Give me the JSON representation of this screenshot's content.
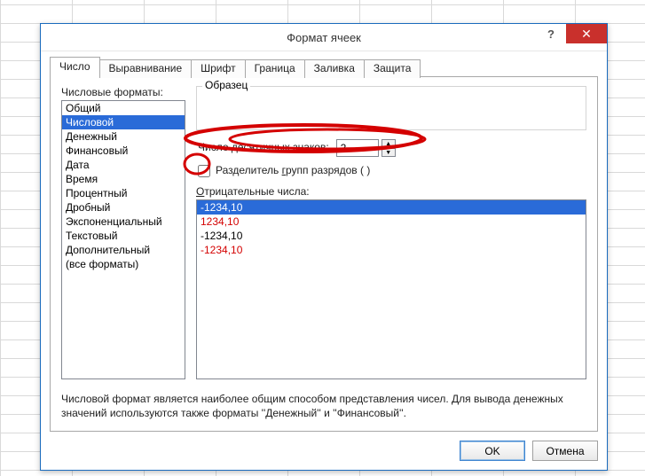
{
  "window": {
    "title": "Формат ячеек",
    "help": "?",
    "close": "✕"
  },
  "tabs": {
    "number": "Число",
    "alignment": "Выравнивание",
    "font": "Шрифт",
    "border": "Граница",
    "fill": "Заливка",
    "protection": "Защита"
  },
  "labels": {
    "formats": "Числовые форматы:",
    "sample": "Образец",
    "decimals_pre": "Число десятичных ",
    "decimals_under": "з",
    "decimals_post": "наков:",
    "thousands_pre": "Разделитель ",
    "thousands_under": "г",
    "thousands_post": "рупп разрядов ( )",
    "negatives_pre": "",
    "negatives_under": "О",
    "negatives_post": "трицательные числа:"
  },
  "formats": {
    "items": [
      {
        "label": "Общий"
      },
      {
        "label": "Числовой"
      },
      {
        "label": "Денежный"
      },
      {
        "label": "Финансовый"
      },
      {
        "label": "Дата"
      },
      {
        "label": "Время"
      },
      {
        "label": "Процентный"
      },
      {
        "label": "Дробный"
      },
      {
        "label": "Экспоненциальный"
      },
      {
        "label": "Текстовый"
      },
      {
        "label": "Дополнительный"
      },
      {
        "label": "(все форматы)"
      }
    ],
    "selected_index": 1
  },
  "decimals": {
    "value": "2",
    "up": "▲",
    "down": "▼"
  },
  "thousands_checked": false,
  "negatives": {
    "items": [
      {
        "label": "-1234,10",
        "red": false
      },
      {
        "label": "1234,10",
        "red": true
      },
      {
        "label": "-1234,10",
        "red": false
      },
      {
        "label": "-1234,10",
        "red": true
      }
    ],
    "selected_index": 0
  },
  "description": "Числовой формат является наиболее общим способом представления чисел. Для вывода денежных значений используются также форматы ''Денежный'' и ''Финансовый''.",
  "buttons": {
    "ok": "OK",
    "cancel": "Отмена"
  }
}
